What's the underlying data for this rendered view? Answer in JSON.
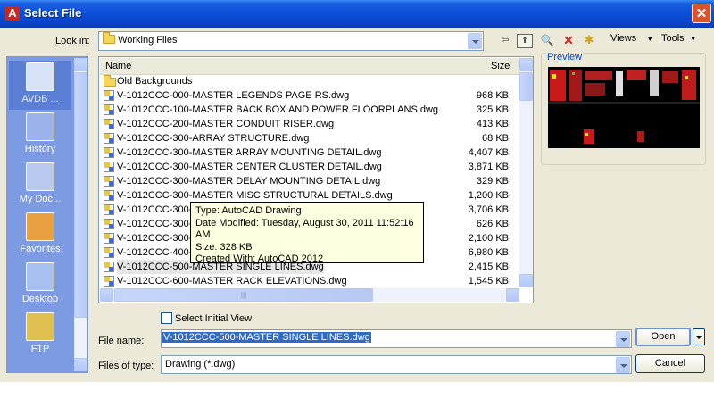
{
  "window": {
    "title": "Select File",
    "close": "✕"
  },
  "look_in": {
    "label": "Look in:",
    "value": "Working Files"
  },
  "toolbar": {
    "back": "⇦",
    "up": "⬆",
    "search": "🔍",
    "delete": "✕",
    "new_folder": "✱",
    "views": "Views",
    "tools": "Tools"
  },
  "places": [
    "AVDB ...",
    "History",
    "My Doc...",
    "Favorites",
    "Desktop",
    "FTP"
  ],
  "list": {
    "columns": {
      "name": "Name",
      "size": "Size"
    },
    "folder": "Old Backgrounds",
    "files": [
      {
        "name": "V-1012CCC-000-MASTER LEGENDS PAGE RS.dwg",
        "size": "968 KB"
      },
      {
        "name": "V-1012CCC-100-MASTER BACK BOX AND POWER FLOORPLANS.dwg",
        "size": "325 KB"
      },
      {
        "name": "V-1012CCC-200-MASTER CONDUIT RISER.dwg",
        "size": "413 KB"
      },
      {
        "name": "V-1012CCC-300-ARRAY STRUCTURE.dwg",
        "size": "68 KB"
      },
      {
        "name": "V-1012CCC-300-MASTER ARRAY MOUNTING DETAIL.dwg",
        "size": "4,407 KB"
      },
      {
        "name": "V-1012CCC-300-MASTER CENTER CLUSTER DETAIL.dwg",
        "size": "3,871 KB"
      },
      {
        "name": "V-1012CCC-300-MASTER DELAY MOUNTING DETAIL.dwg",
        "size": "329 KB"
      },
      {
        "name": "V-1012CCC-300-MASTER MISC STRUCTURAL DETAILS.dwg",
        "size": "1,200 KB"
      },
      {
        "name": "V-1012CCC-300-M",
        "size": "3,706 KB"
      },
      {
        "name": "V-1012CCC-300-M",
        "size": "626 KB"
      },
      {
        "name": "V-1012CCC-300-M",
        "size": "2,100 KB"
      },
      {
        "name": "V-1012CCC-400-M",
        "size": "6,980 KB"
      },
      {
        "name": "V-1012CCC-500-MASTER SINGLE LINES.dwg",
        "size": "2,415 KB"
      },
      {
        "name": "V-1012CCC-600-MASTER RACK ELEVATIONS.dwg",
        "size": "1,545 KB"
      }
    ],
    "hscroll_grip": "|||"
  },
  "tooltip": {
    "type": "Type: AutoCAD Drawing",
    "modified": "Date Modified: Tuesday, August 30, 2011 11:52:16 AM",
    "size": "Size: 328 KB",
    "created": "Created With: AutoCAD 2012"
  },
  "preview": {
    "label": "Preview"
  },
  "select_initial_view": {
    "label": "Select Initial View"
  },
  "file_name": {
    "label": "File name:",
    "value": "V-1012CCC-500-MASTER SINGLE LINES.dwg"
  },
  "file_type": {
    "label": "Files of type:",
    "value": "Drawing (*.dwg)"
  },
  "buttons": {
    "open": "Open",
    "cancel": "Cancel"
  },
  "colors": {
    "titlebar": "#0a4ed8",
    "places_bg": "#7d9be3",
    "selection": "#316ac5",
    "tooltip_bg": "#ffffe1"
  }
}
